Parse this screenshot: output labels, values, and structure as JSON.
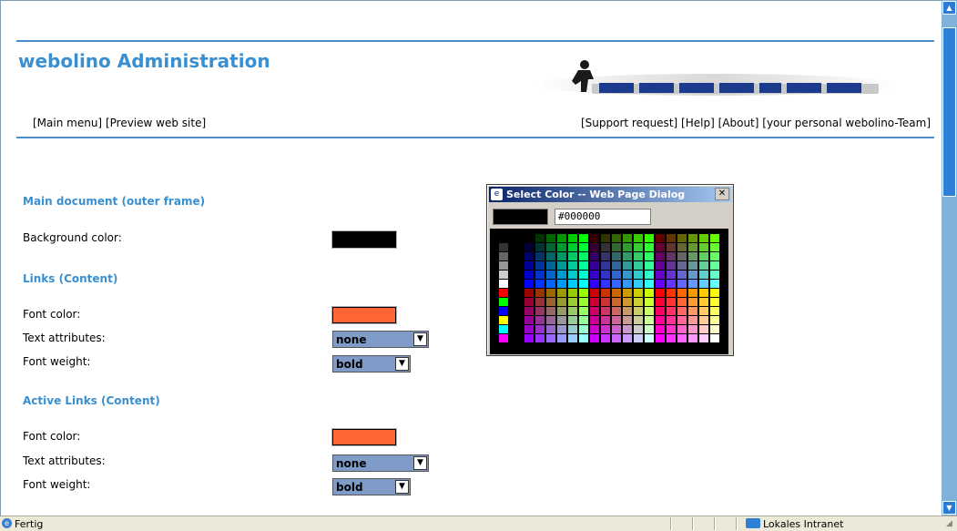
{
  "header": {
    "title": "webolino Administration",
    "nav_left": [
      "[Main menu]",
      "[Preview web site]"
    ],
    "nav_right": [
      "[Support request]",
      "[Help]",
      "[About]",
      "[your personal webolino-Team]"
    ]
  },
  "sections": {
    "main_doc": {
      "title": "Main document (outer frame)",
      "bg_label": "Background color:",
      "bg_color": "#000000"
    },
    "links": {
      "title": "Links (Content)",
      "font_color_label": "Font color:",
      "font_color": "#ff6633",
      "text_attr_label": "Text attributes:",
      "text_attr_value": "none",
      "font_weight_label": "Font weight:",
      "font_weight_value": "bold"
    },
    "active_links": {
      "title": "Active Links (Content)",
      "font_color_label": "Font color:",
      "font_color": "#ff6633",
      "text_attr_label": "Text attributes:",
      "text_attr_value": "none",
      "font_weight_label": "Font weight:",
      "font_weight_value": "bold"
    }
  },
  "dialog": {
    "title": "Select Color -- Web Page Dialog",
    "hex_value": "#000000",
    "preview_color": "#000000"
  },
  "status": {
    "text": "Fertig",
    "zone": "Lokales Intranet"
  },
  "colors": {
    "accent": "#3a8fd0",
    "rule": "#4a8cc7"
  }
}
